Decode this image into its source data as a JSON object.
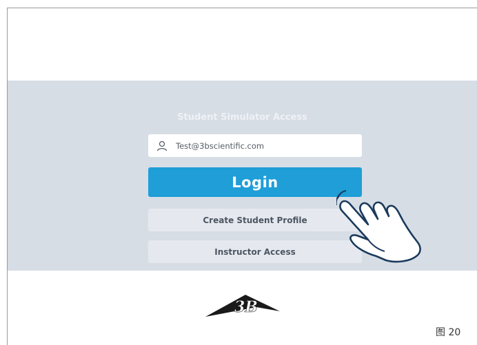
{
  "panel": {
    "title": "Student Simulator Access",
    "email": {
      "value": "Test@3bscientific.com",
      "icon": "user-icon"
    },
    "login_label": "Login",
    "create_profile_label": "Create Student Profile",
    "instructor_access_label": "Instructor Access"
  },
  "figure_label": "图 20",
  "logo": {
    "text": "3B",
    "icon": "3b-scientific-logo"
  },
  "colors": {
    "panel_bg": "#d7dde5",
    "primary": "#1f9ed8",
    "secondary_btn": "#e5e9ef",
    "hand_outline": "#1a3a5c"
  }
}
